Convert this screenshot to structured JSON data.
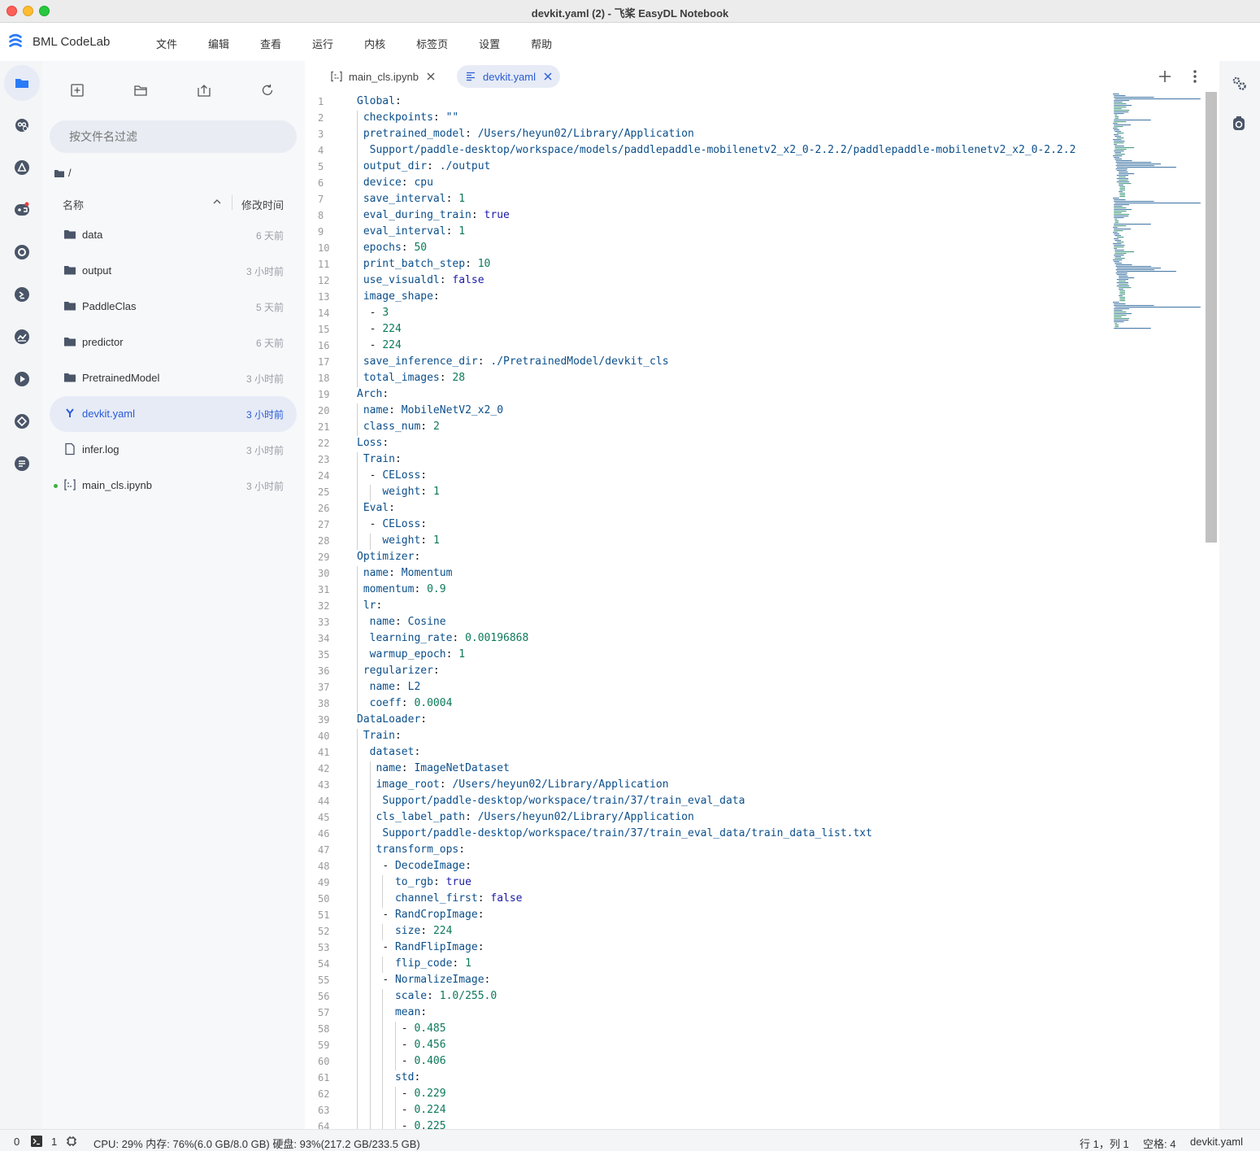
{
  "window": {
    "title": "devkit.yaml (2) - 飞桨 EasyDL Notebook"
  },
  "brand": {
    "name": "BML CodeLab"
  },
  "menu": [
    "文件",
    "编辑",
    "查看",
    "运行",
    "内核",
    "标签页",
    "设置",
    "帮助"
  ],
  "activity_icons": [
    "folder-icon",
    "extension-icon",
    "warning-icon",
    "robot-icon",
    "circle-icon",
    "terminal-icon",
    "chart-icon",
    "play-icon",
    "diamond-icon",
    "document-icon"
  ],
  "filebrowser": {
    "filter_placeholder": "按文件名过滤",
    "path": "/",
    "col_name": "名称",
    "col_time": "修改时间",
    "files": [
      {
        "name": "data",
        "time": "6 天前",
        "type": "folder"
      },
      {
        "name": "output",
        "time": "3 小时前",
        "type": "folder"
      },
      {
        "name": "PaddleClas",
        "time": "5 天前",
        "type": "folder"
      },
      {
        "name": "predictor",
        "time": "6 天前",
        "type": "folder"
      },
      {
        "name": "PretrainedModel",
        "time": "3 小时前",
        "type": "folder"
      },
      {
        "name": "devkit.yaml",
        "time": "3 小时前",
        "type": "yaml",
        "selected": true
      },
      {
        "name": "infer.log",
        "time": "3 小时前",
        "type": "file"
      },
      {
        "name": "main_cls.ipynb",
        "time": "3 小时前",
        "type": "notebook",
        "running": true
      }
    ]
  },
  "tabs": [
    {
      "label": "main_cls.ipynb",
      "active": false
    },
    {
      "label": "devkit.yaml",
      "active": true
    }
  ],
  "code": [
    {
      "n": "1",
      "i": 0,
      "k": "Global",
      "v": ""
    },
    {
      "n": "2",
      "i": 1,
      "k": "checkpoints",
      "v": "\"\"",
      "t": "s"
    },
    {
      "n": "3",
      "i": 1,
      "k": "pretrained_model",
      "v": "/Users/heyun02/Library/Application",
      "t": "s"
    },
    {
      "n": "4",
      "i": 2,
      "raw": "Support/paddle-desktop/workspace/models/paddlepaddle-mobilenetv2_x2_0-2.2.2/paddlepaddle-mobilenetv2_x2_0-2.2.2",
      "t": "s"
    },
    {
      "n": "5",
      "i": 1,
      "k": "output_dir",
      "v": "./output",
      "t": "s"
    },
    {
      "n": "6",
      "i": 1,
      "k": "device",
      "v": "cpu",
      "t": "s"
    },
    {
      "n": "7",
      "i": 1,
      "k": "save_interval",
      "v": "1",
      "t": "n"
    },
    {
      "n": "8",
      "i": 1,
      "k": "eval_during_train",
      "v": "true",
      "t": "b"
    },
    {
      "n": "9",
      "i": 1,
      "k": "eval_interval",
      "v": "1",
      "t": "n"
    },
    {
      "n": "10",
      "i": 1,
      "k": "epochs",
      "v": "50",
      "t": "n"
    },
    {
      "n": "11",
      "i": 1,
      "k": "print_batch_step",
      "v": "10",
      "t": "n"
    },
    {
      "n": "12",
      "i": 1,
      "k": "use_visualdl",
      "v": "false",
      "t": "b"
    },
    {
      "n": "13",
      "i": 1,
      "k": "image_shape",
      "v": ""
    },
    {
      "n": "14",
      "i": 2,
      "li": "3",
      "t": "n"
    },
    {
      "n": "15",
      "i": 2,
      "li": "224",
      "t": "n"
    },
    {
      "n": "16",
      "i": 2,
      "li": "224",
      "t": "n"
    },
    {
      "n": "17",
      "i": 1,
      "k": "save_inference_dir",
      "v": "./PretrainedModel/devkit_cls",
      "t": "s"
    },
    {
      "n": "18",
      "i": 1,
      "k": "total_images",
      "v": "28",
      "t": "n"
    },
    {
      "n": "19",
      "i": 0,
      "k": "Arch",
      "v": ""
    },
    {
      "n": "20",
      "i": 1,
      "k": "name",
      "v": "MobileNetV2_x2_0",
      "t": "s"
    },
    {
      "n": "21",
      "i": 1,
      "k": "class_num",
      "v": "2",
      "t": "n"
    },
    {
      "n": "22",
      "i": 0,
      "k": "Loss",
      "v": ""
    },
    {
      "n": "23",
      "i": 1,
      "k": "Train",
      "v": ""
    },
    {
      "n": "24",
      "i": 2,
      "lk": "CELoss"
    },
    {
      "n": "25",
      "i": 4,
      "k": "weight",
      "v": "1",
      "t": "n"
    },
    {
      "n": "26",
      "i": 1,
      "k": "Eval",
      "v": ""
    },
    {
      "n": "27",
      "i": 2,
      "lk": "CELoss"
    },
    {
      "n": "28",
      "i": 4,
      "k": "weight",
      "v": "1",
      "t": "n"
    },
    {
      "n": "29",
      "i": 0,
      "k": "Optimizer",
      "v": ""
    },
    {
      "n": "30",
      "i": 1,
      "k": "name",
      "v": "Momentum",
      "t": "s"
    },
    {
      "n": "31",
      "i": 1,
      "k": "momentum",
      "v": "0.9",
      "t": "n"
    },
    {
      "n": "32",
      "i": 1,
      "k": "lr",
      "v": ""
    },
    {
      "n": "33",
      "i": 2,
      "k": "name",
      "v": "Cosine",
      "t": "s"
    },
    {
      "n": "34",
      "i": 2,
      "k": "learning_rate",
      "v": "0.00196868",
      "t": "n"
    },
    {
      "n": "35",
      "i": 2,
      "k": "warmup_epoch",
      "v": "1",
      "t": "n"
    },
    {
      "n": "36",
      "i": 1,
      "k": "regularizer",
      "v": ""
    },
    {
      "n": "37",
      "i": 2,
      "k": "name",
      "v": "L2",
      "t": "s"
    },
    {
      "n": "38",
      "i": 2,
      "k": "coeff",
      "v": "0.0004",
      "t": "n"
    },
    {
      "n": "39",
      "i": 0,
      "k": "DataLoader",
      "v": ""
    },
    {
      "n": "40",
      "i": 1,
      "k": "Train",
      "v": ""
    },
    {
      "n": "41",
      "i": 2,
      "k": "dataset",
      "v": ""
    },
    {
      "n": "42",
      "i": 3,
      "k": "name",
      "v": "ImageNetDataset",
      "t": "s"
    },
    {
      "n": "43",
      "i": 3,
      "k": "image_root",
      "v": "/Users/heyun02/Library/Application",
      "t": "s"
    },
    {
      "n": "44",
      "i": 4,
      "raw": "Support/paddle-desktop/workspace/train/37/train_eval_data",
      "t": "s"
    },
    {
      "n": "45",
      "i": 3,
      "k": "cls_label_path",
      "v": "/Users/heyun02/Library/Application",
      "t": "s"
    },
    {
      "n": "46",
      "i": 4,
      "raw": "Support/paddle-desktop/workspace/train/37/train_eval_data/train_data_list.txt",
      "t": "s"
    },
    {
      "n": "47",
      "i": 3,
      "k": "transform_ops",
      "v": ""
    },
    {
      "n": "48",
      "i": 4,
      "lk": "DecodeImage"
    },
    {
      "n": "49",
      "i": 6,
      "k": "to_rgb",
      "v": "true",
      "t": "b"
    },
    {
      "n": "50",
      "i": 6,
      "k": "channel_first",
      "v": "false",
      "t": "b"
    },
    {
      "n": "51",
      "i": 4,
      "lk": "RandCropImage"
    },
    {
      "n": "52",
      "i": 6,
      "k": "size",
      "v": "224",
      "t": "n"
    },
    {
      "n": "53",
      "i": 4,
      "lk": "RandFlipImage"
    },
    {
      "n": "54",
      "i": 6,
      "k": "flip_code",
      "v": "1",
      "t": "n"
    },
    {
      "n": "55",
      "i": 4,
      "lk": "NormalizeImage"
    },
    {
      "n": "56",
      "i": 6,
      "k": "scale",
      "v": "1.0/255.0",
      "t": "n"
    },
    {
      "n": "57",
      "i": 6,
      "k": "mean",
      "v": ""
    },
    {
      "n": "58",
      "i": 7,
      "li": "0.485",
      "t": "n"
    },
    {
      "n": "59",
      "i": 7,
      "li": "0.456",
      "t": "n"
    },
    {
      "n": "60",
      "i": 7,
      "li": "0.406",
      "t": "n"
    },
    {
      "n": "61",
      "i": 6,
      "k": "std",
      "v": ""
    },
    {
      "n": "62",
      "i": 7,
      "li": "0.229",
      "t": "n"
    },
    {
      "n": "63",
      "i": 7,
      "li": "0.224",
      "t": "n"
    },
    {
      "n": "64",
      "i": 7,
      "li": "0.225",
      "t": "n"
    }
  ],
  "statusbar": {
    "kernels": "0",
    "terminals": "1",
    "resources": "CPU:  29% 内存:  76%(6.0 GB/8.0 GB) 硬盘:  93%(217.2 GB/233.5 GB)",
    "cursor": "行 1，列 1",
    "indent": "空格: 4",
    "filename": "devkit.yaml"
  },
  "colors": {
    "accent": "#2a5bd7",
    "key": "#0b4f8b",
    "number": "#0c7a5a",
    "bool": "#1a1aa6"
  }
}
